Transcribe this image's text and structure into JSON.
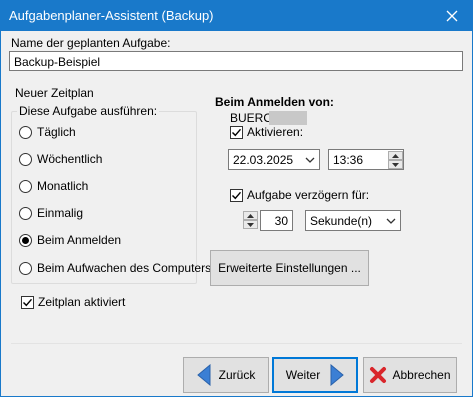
{
  "window": {
    "title": "Aufgabenplaner-Assistent (Backup)"
  },
  "task_name": {
    "label": "Name der geplanten Aufgabe:",
    "value": "Backup-Beispiel"
  },
  "schedule": {
    "heading": "Neuer Zeitplan",
    "group_label": "Diese Aufgabe ausführen:",
    "options": [
      "Täglich",
      "Wöchentlich",
      "Monatlich",
      "Einmalig",
      "Beim Anmelden",
      "Beim Aufwachen des Computers"
    ],
    "selected": "Beim Anmelden",
    "enabled_label": "Zeitplan aktiviert",
    "enabled": true
  },
  "logon": {
    "heading": "Beim Anmelden von:",
    "user_prefix": "BUERO\\",
    "activate_label": "Aktivieren:",
    "activate_checked": true,
    "date": "22.03.2025",
    "time": "13:36",
    "delay_label": "Aufgabe verzögern für:",
    "delay_checked": true,
    "delay_value": "30",
    "delay_unit": "Sekunde(n)"
  },
  "buttons": {
    "advanced": "Erweiterte Einstellungen ...",
    "back": "Zurück",
    "next": "Weiter",
    "cancel": "Abbrechen"
  },
  "colors": {
    "titlebar": "#1979ca",
    "arrow_blue": "#3b7fd4",
    "cancel_red": "#d9262b"
  }
}
